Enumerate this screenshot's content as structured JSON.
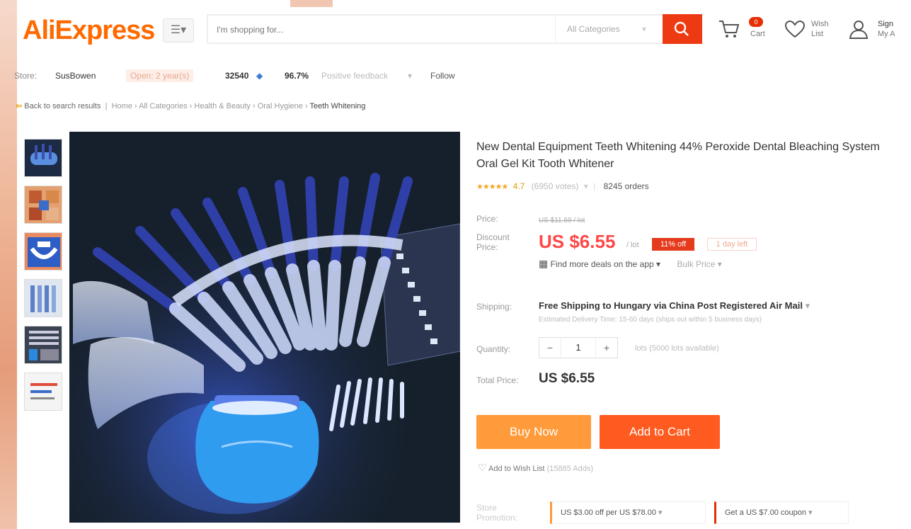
{
  "header": {
    "logo": "AliExpress",
    "search_placeholder": "I'm shopping for...",
    "category_select": "All Categories",
    "cart_count": "0",
    "cart_label": "Cart",
    "wish_label_1": "Wish",
    "wish_label_2": "List",
    "sign_label_1": "Sign",
    "sign_label_2": "My A"
  },
  "store": {
    "label": "Store:",
    "name": "SusBowen",
    "opened": "Open: 2 year(s)",
    "score": "32540",
    "positive": "96.7%",
    "feedback_label": "Positive feedback",
    "follow": "Follow"
  },
  "breadcrumb": {
    "back": "Back to search results",
    "items": [
      "Home",
      "All Categories",
      "Health & Beauty",
      "Oral Hygiene",
      "Teeth Whitening"
    ]
  },
  "product": {
    "title": "New Dental Equipment Teeth Whitening 44% Peroxide Dental Bleaching System Oral Gel Kit Tooth Whitener",
    "rating": "4.7",
    "stars": "★★★★★",
    "votes": "(6950 votes)",
    "orders": "8245 orders",
    "price_label": "Price:",
    "price_original": "US $11.69 / lot",
    "discount_label_1": "Discount",
    "discount_label_2": "Price:",
    "price_discount": "US $6.55",
    "per_lot": "/ lot",
    "off_badge": "11% off",
    "days_left": "1 day left",
    "app_deal": "Find more deals on the app",
    "bulk_price": "Bulk Price",
    "shipping_label": "Shipping:",
    "shipping_main": "Free Shipping to Hungary via China Post Registered Air Mail",
    "shipping_sub": "Estimated Delivery Time: 15-60 days (ships out within 5 business days)",
    "quantity_label": "Quantity:",
    "quantity_value": "1",
    "quantity_note": "lots (5000 lots available)",
    "total_label": "Total Price:",
    "total_value": "US $6.55",
    "buy_now": "Buy Now",
    "add_to_cart": "Add to Cart",
    "wish_text": "Add to Wish List",
    "wish_count": "(15885 Adds)",
    "promo_label_1": "Store",
    "promo_label_2": "Promotion:",
    "promo_1": "US $3.00 off per US $78.00",
    "promo_2": "Get a US $7.00 coupon"
  },
  "colors": {
    "brand_orange": "#ff6a00",
    "search_red": "#ee3a12",
    "price_red": "#ff4747",
    "buy_now": "#ff9b3a",
    "add_to_cart": "#ff5a1f"
  }
}
